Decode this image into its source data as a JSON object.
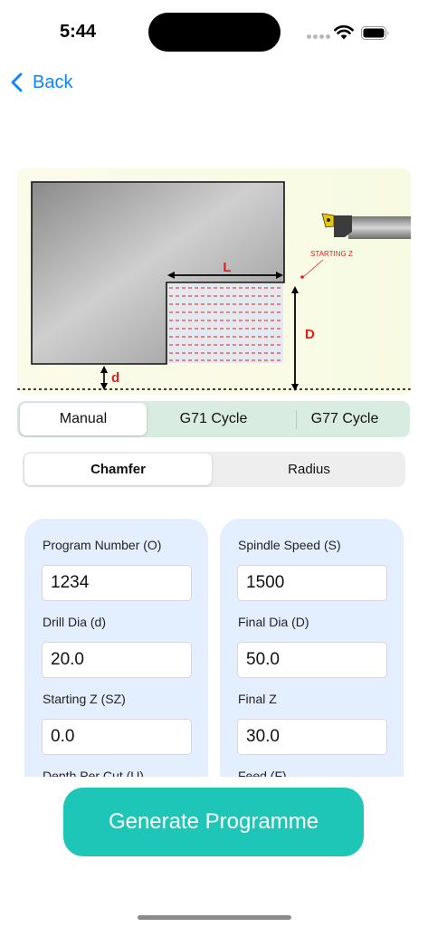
{
  "status_bar": {
    "time": "5:44"
  },
  "nav": {
    "back_label": "Back",
    "accent_color": "#0a84ff"
  },
  "diagram": {
    "label_length": "L",
    "label_final_depth": "D",
    "label_drill_dia": "d",
    "label_starting_z": "STARTING  Z",
    "annotation_color": "#e11d1d"
  },
  "mode_tabs": {
    "selected": "Manual",
    "items": [
      {
        "label": "Manual"
      },
      {
        "label": "G71 Cycle"
      },
      {
        "label": "G77 Cycle"
      }
    ]
  },
  "shape_tabs": {
    "selected": "Chamfer",
    "items": [
      {
        "label": "Chamfer"
      },
      {
        "label": "Radius"
      }
    ]
  },
  "form": {
    "left": {
      "fields": [
        {
          "label": "Program Number (O)",
          "value": "1234"
        },
        {
          "label": "Drill Dia (d)",
          "value": "20.0"
        },
        {
          "label": "Starting Z (SZ)",
          "value": "0.0"
        },
        {
          "label": "Depth Per Cut (U)"
        }
      ]
    },
    "right": {
      "fields": [
        {
          "label": "Spindle Speed (S)",
          "value": "1500"
        },
        {
          "label": "Final Dia (D)",
          "value": "50.0"
        },
        {
          "label": "Final Z",
          "value": "30.0"
        },
        {
          "label": "Feed (F)"
        }
      ]
    }
  },
  "generate_button": {
    "label": "Generate Programme",
    "color": "#1dc6b6"
  }
}
